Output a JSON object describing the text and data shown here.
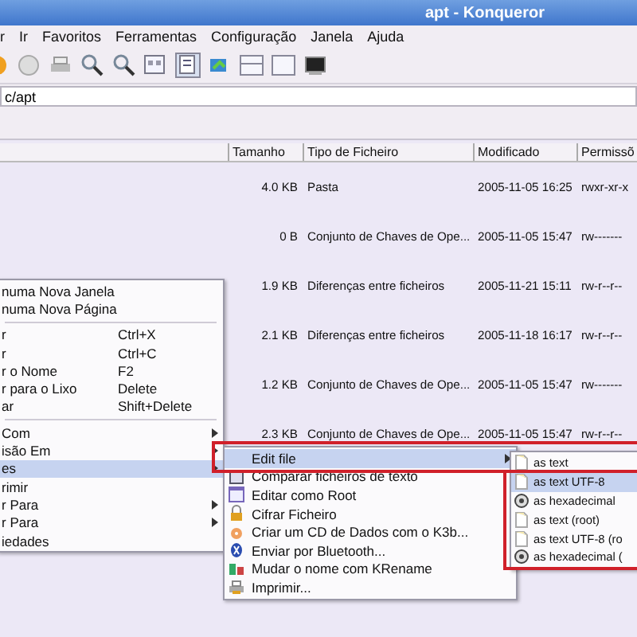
{
  "window": {
    "title": "apt - Konqueror"
  },
  "menu_bar": [
    {
      "label": "r"
    },
    {
      "label": "Ir"
    },
    {
      "label": "Favoritos"
    },
    {
      "label": "Ferramentas"
    },
    {
      "label": "Configuração"
    },
    {
      "label": "Janela"
    },
    {
      "label": "Ajuda"
    }
  ],
  "location": {
    "value": "c/apt"
  },
  "file_list": {
    "columns": [
      "Tamanho",
      "Tipo de Ficheiro",
      "Modificado",
      "Permissõ"
    ],
    "rows": [
      {
        "size": "4.0 KB",
        "type": "Pasta",
        "modified": "2005-11-05 16:25",
        "permissions": "rwxr-xr-x"
      },
      {
        "size": "0 B",
        "type": "Conjunto de Chaves de Ope...",
        "modified": "2005-11-05 15:47",
        "permissions": "rw-------"
      },
      {
        "size": "1.9 KB",
        "type": "Diferenças entre ficheiros",
        "modified": "2005-11-21 15:11",
        "permissions": "rw-r--r--"
      },
      {
        "size": "2.1 KB",
        "type": "Diferenças entre ficheiros",
        "modified": "2005-11-18 16:17",
        "permissions": "rw-r--r--"
      },
      {
        "size": "1.2 KB",
        "type": "Conjunto de Chaves de Ope...",
        "modified": "2005-11-05 15:47",
        "permissions": "rw-------"
      },
      {
        "size": "2.3 KB",
        "type": "Conjunto de Chaves de Ope...",
        "modified": "2005-11-05 15:47",
        "permissions": "rw-r--r--"
      }
    ]
  },
  "context_menu": {
    "items": [
      {
        "kind": "item",
        "label": "numa Nova Janela",
        "has_submenu": false,
        "selected": false
      },
      {
        "kind": "item",
        "label": "numa Nova Página",
        "has_submenu": false,
        "selected": false
      },
      {
        "kind": "separator"
      },
      {
        "kind": "item",
        "label": "r",
        "shortcut": "Ctrl+X",
        "has_submenu": false,
        "selected": false
      },
      {
        "kind": "item",
        "label": "r",
        "shortcut": "Ctrl+C",
        "has_submenu": false,
        "selected": false
      },
      {
        "kind": "item",
        "label": "r o Nome",
        "shortcut": "F2",
        "has_submenu": false,
        "selected": false
      },
      {
        "kind": "item",
        "label": "r para o Lixo",
        "shortcut": "Delete",
        "has_submenu": false,
        "selected": false
      },
      {
        "kind": "item",
        "label": "ar",
        "shortcut": "Shift+Delete",
        "has_submenu": false,
        "selected": false
      },
      {
        "kind": "separator"
      },
      {
        "kind": "item",
        "label": "Com",
        "has_submenu": true,
        "selected": false
      },
      {
        "kind": "item",
        "label": "isão Em",
        "has_submenu": true,
        "selected": false
      },
      {
        "kind": "item",
        "label": "es",
        "has_submenu": true,
        "selected": true
      },
      {
        "kind": "item",
        "label": "rimir",
        "has_submenu": false,
        "selected": false
      },
      {
        "kind": "item",
        "label": "r Para",
        "has_submenu": true,
        "selected": false
      },
      {
        "kind": "item",
        "label": "r Para",
        "has_submenu": true,
        "selected": false
      },
      {
        "kind": "item",
        "label": "iedades",
        "has_submenu": false,
        "selected": false
      }
    ]
  },
  "actions_submenu": {
    "items": [
      {
        "label": "Edit file",
        "has_submenu": true,
        "selected": true
      },
      {
        "label": "Comparar ficheiros de texto",
        "has_submenu": false,
        "selected": false
      },
      {
        "label": "Editar como Root",
        "has_submenu": false,
        "selected": false
      },
      {
        "label": "Cifrar Ficheiro",
        "has_submenu": false,
        "selected": false
      },
      {
        "label": "Criar um CD de Dados com o K3b...",
        "has_submenu": false,
        "selected": false
      },
      {
        "label": "Enviar por Bluetooth...",
        "has_submenu": false,
        "selected": false
      },
      {
        "label": "Mudar o nome com KRename",
        "has_submenu": false,
        "selected": false
      },
      {
        "label": "Imprimir...",
        "has_submenu": false,
        "selected": false
      }
    ]
  },
  "edit_submenu": {
    "items": [
      {
        "label": "as text",
        "selected": false
      },
      {
        "label": "as text UTF-8",
        "selected": true
      },
      {
        "label": "as hexadecimal",
        "selected": false
      },
      {
        "label": "as text (root)",
        "selected": false
      },
      {
        "label": "as text UTF-8 (ro",
        "selected": false
      },
      {
        "label": "as hexadecimal (",
        "selected": false
      }
    ]
  }
}
